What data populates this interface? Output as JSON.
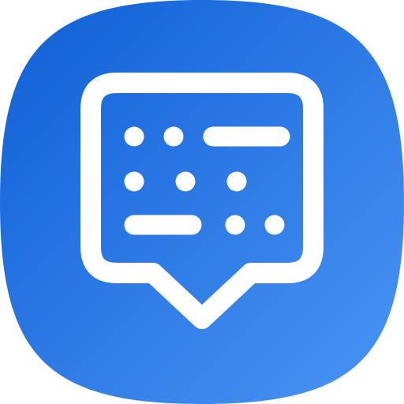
{
  "app_icon": {
    "icon_name": "morse-chat-bubble-icon",
    "background_gradient": {
      "from": "#0F5FD6",
      "to": "#4A95F5"
    },
    "glyph_color": "#FFFFFF",
    "morse_rows": [
      [
        "dot",
        "dot",
        "dash"
      ],
      [
        "dot",
        "dot",
        "dot"
      ],
      [
        "dash",
        "dot",
        "dot"
      ]
    ]
  }
}
